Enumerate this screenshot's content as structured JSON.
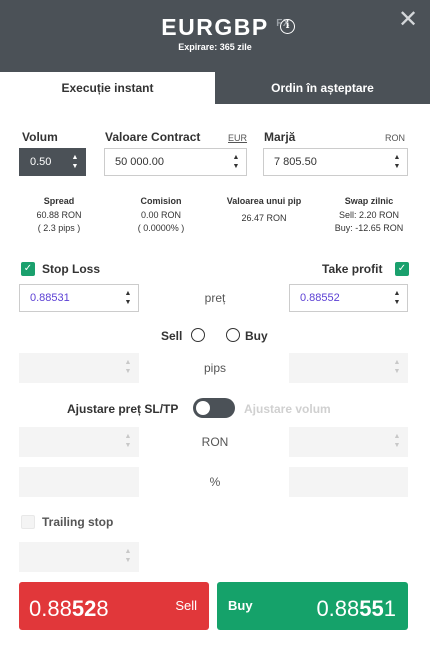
{
  "header": {
    "symbol": "EURGBP",
    "asset_class": "FX",
    "expiry": "Expirare: 365 zile",
    "info_icon": "info-circle-icon",
    "close_icon": "close-x-icon"
  },
  "tabs": [
    {
      "label": "Execuție instant",
      "active": true
    },
    {
      "label": "Ordin în așteptare",
      "active": false
    }
  ],
  "volume": {
    "label": "Volum",
    "value": "0.50"
  },
  "contract_value": {
    "label": "Valoare Contract",
    "currency": "EUR",
    "value": "50 000.00"
  },
  "margin": {
    "label": "Marjă",
    "currency": "RON",
    "value": "7 805.50"
  },
  "stats": {
    "spread": {
      "title": "Spread",
      "line1": "60.88 RON",
      "line2": "( 2.3 pips )"
    },
    "commission": {
      "title": "Comision",
      "line1": "0.00 RON",
      "line2": "( 0.0000% )"
    },
    "pip_value": {
      "title": "Valoarea unui pip",
      "line1": "26.47 RON"
    },
    "swap": {
      "title": "Swap zilnic",
      "line1": "Sell: 2.20 RON",
      "line2": "Buy: -12.65 RON"
    }
  },
  "stop_loss": {
    "label": "Stop Loss",
    "checked": true,
    "value": "0.88531"
  },
  "take_profit": {
    "label": "Take profit",
    "checked": true,
    "value": "0.88552"
  },
  "price_label": "preț",
  "direction": {
    "sell_label": "Sell",
    "buy_label": "Buy"
  },
  "pips_label": "pips",
  "adjust": {
    "left_label": "Ajustare preț SL/TP",
    "right_label": "Ajustare volum"
  },
  "ron_label": "RON",
  "percent_label": "%",
  "trailing_stop": {
    "label": "Trailing stop",
    "checked": false
  },
  "sell_button": {
    "label": "Sell",
    "price_prefix": "0.88",
    "price_big": "52",
    "price_suffix": "8"
  },
  "buy_button": {
    "label": "Buy",
    "price_prefix": "0.88",
    "price_big": "55",
    "price_suffix": "1"
  },
  "colors": {
    "header_bg": "#4b5157",
    "sell": "#e1373a",
    "buy": "#15a26a",
    "checkbox": "#1aa06d",
    "sltp_value": "#5b3fd4"
  }
}
